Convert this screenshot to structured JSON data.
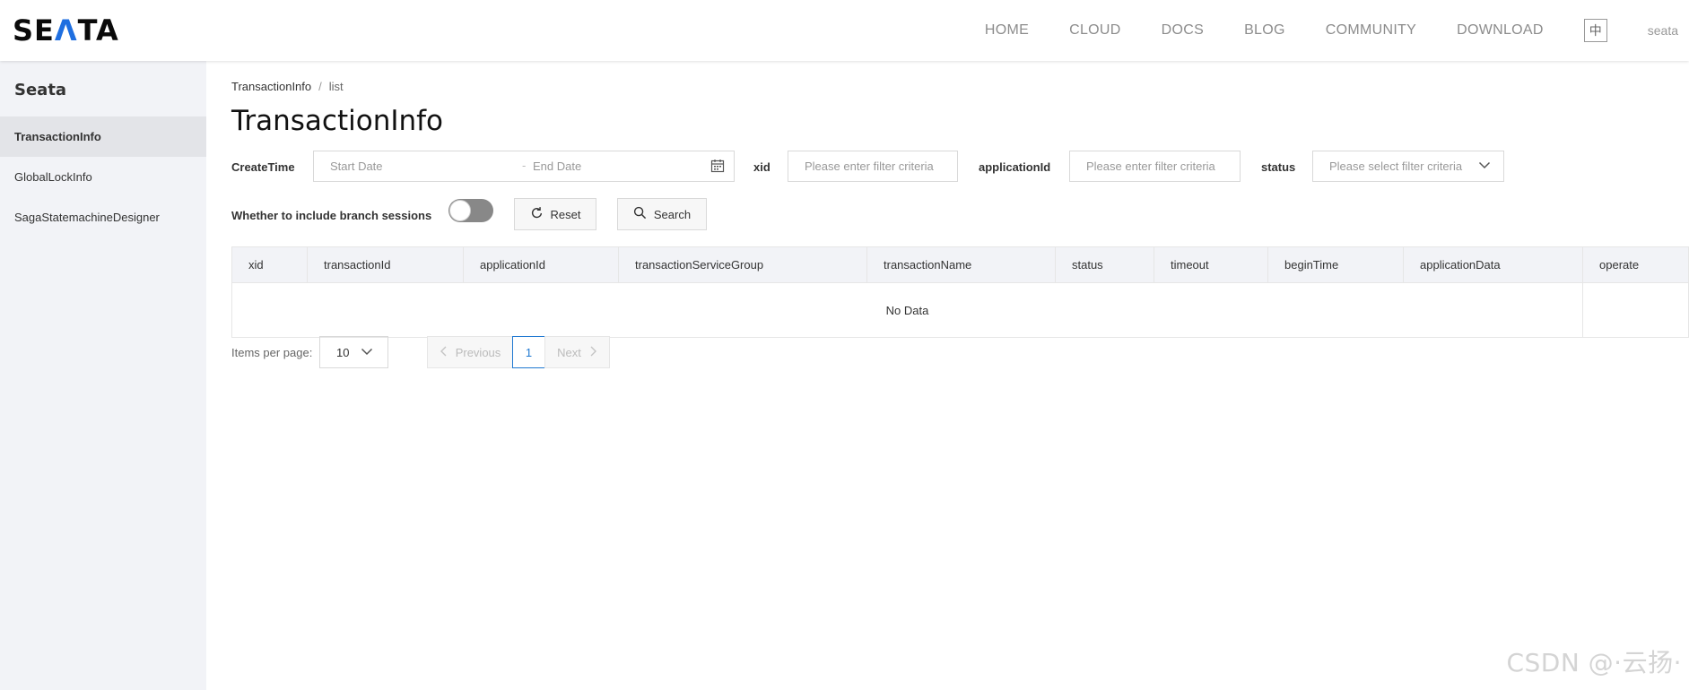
{
  "brand": {
    "logo_text_a": "SE",
    "logo_text_b": "Λ",
    "logo_text_c": "TA"
  },
  "nav": {
    "items": [
      "HOME",
      "CLOUD",
      "DOCS",
      "BLOG",
      "COMMUNITY",
      "DOWNLOAD"
    ],
    "lang": "中",
    "user": "seata"
  },
  "sidebar": {
    "title": "Seata",
    "items": [
      {
        "label": "TransactionInfo"
      },
      {
        "label": "GlobalLockInfo"
      },
      {
        "label": "SagaStatemachineDesigner"
      }
    ]
  },
  "breadcrumb": {
    "parent": "TransactionInfo",
    "separator": "/",
    "current": "list"
  },
  "page": {
    "title": "TransactionInfo"
  },
  "filters": {
    "createtime_label": "CreateTime",
    "start_placeholder": "Start Date",
    "range_sep": "-",
    "end_placeholder": "End Date",
    "xid_label": "xid",
    "xid_placeholder": "Please enter filter criteria",
    "app_label": "applicationId",
    "app_placeholder": "Please enter filter criteria",
    "status_label": "status",
    "status_placeholder": "Please select filter criteria",
    "branch_label": "Whether to include branch sessions",
    "branch_on": false,
    "reset_label": "Reset",
    "search_label": "Search"
  },
  "table": {
    "columns": [
      "xid",
      "transactionId",
      "applicationId",
      "transactionServiceGroup",
      "transactionName",
      "status",
      "timeout",
      "beginTime",
      "applicationData",
      "operate"
    ],
    "empty_text": "No Data"
  },
  "pagination": {
    "items_label": "Items per page:",
    "page_size": "10",
    "prev_label": "Previous",
    "current_page": "1",
    "next_label": "Next"
  },
  "watermark": "CSDN @·云扬·",
  "colors": {
    "accent": "#1f78d1",
    "logo_accent": "#1f6fe0",
    "sidebar_bg": "#f2f3f7"
  }
}
